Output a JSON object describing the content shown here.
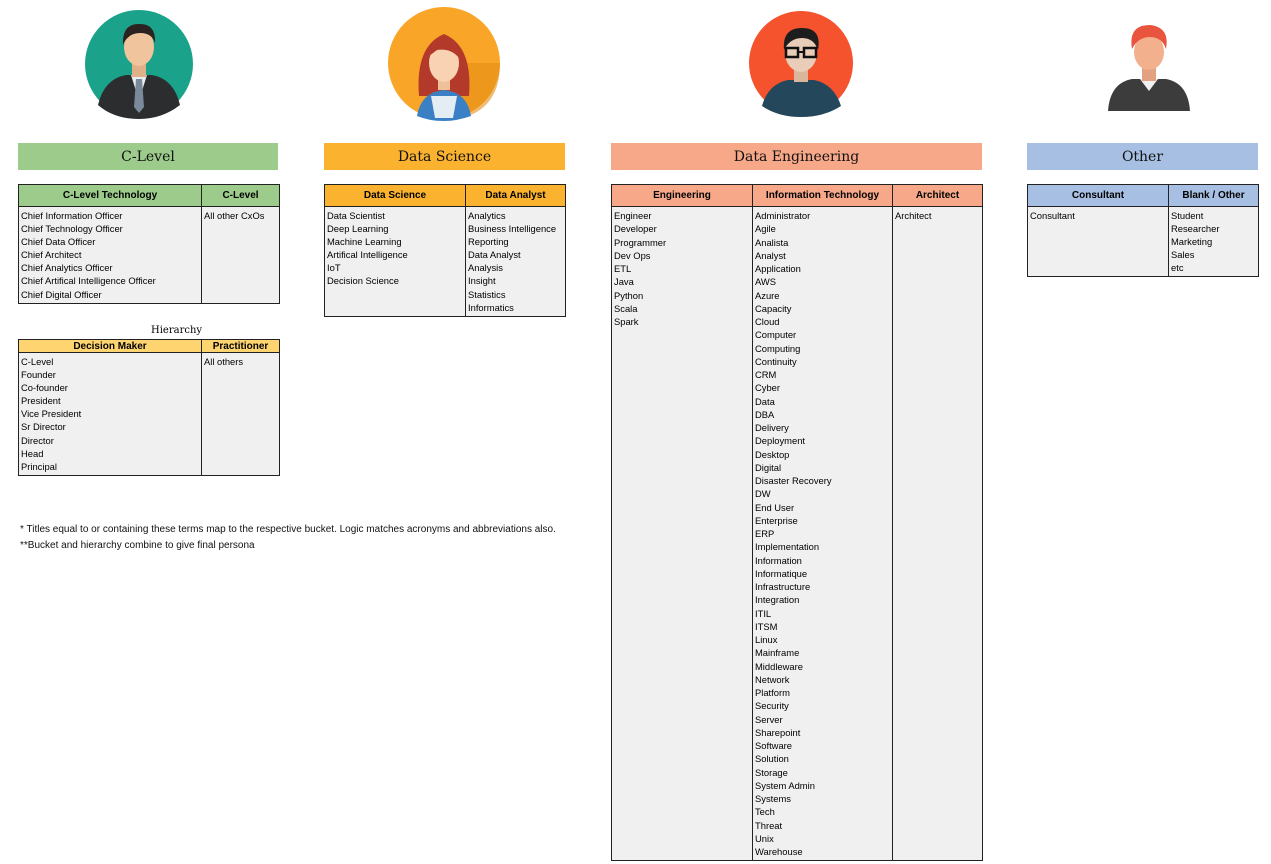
{
  "colors": {
    "clevel": "#9dcb8c",
    "datascience": "#fbb32f",
    "dataeng": "#f6a888",
    "other": "#a6bfe2",
    "hierarchy": "#fdd470"
  },
  "avatars": [
    {
      "name": "man-in-suit-avatar-icon"
    },
    {
      "name": "woman-avatar-icon"
    },
    {
      "name": "man-with-glasses-avatar-icon"
    },
    {
      "name": "redhead-man-avatar-icon"
    }
  ],
  "buckets": {
    "clevel": "C-Level",
    "datascience": "Data Science",
    "dataeng": "Data Engineering",
    "other": "Other"
  },
  "clevel_table": {
    "headers": [
      "C-Level Technology",
      "C-Level"
    ],
    "col1": [
      "Chief Information Officer",
      "Chief Technology Officer",
      "Chief Data Officer",
      "Chief Architect",
      "Chief Analytics Officer",
      "Chief Artifical Intelligence Officer",
      "Chief Digital Officer"
    ],
    "col2": [
      "All other CxOs"
    ]
  },
  "hierarchy": {
    "caption": "Hierarchy",
    "headers": [
      "Decision Maker",
      "Practitioner"
    ],
    "col1": [
      "C-Level",
      "Founder",
      "Co-founder",
      "President",
      "Vice President",
      "Sr Director",
      "Director",
      "Head",
      "Principal"
    ],
    "col2": [
      "All others"
    ]
  },
  "ds_table": {
    "headers": [
      "Data Science",
      "Data Analyst"
    ],
    "col1": [
      "Data Scientist",
      "Deep Learning",
      "Machine Learning",
      "Artifical Intelligence",
      "IoT",
      "Decision Science"
    ],
    "col2": [
      "Analytics",
      "Business Intelligence",
      "Reporting",
      "Data Analyst",
      "Analysis",
      "Insight",
      "Statistics",
      "Informatics"
    ]
  },
  "de_table": {
    "headers": [
      "Engineering",
      "Information Technology",
      "Architect"
    ],
    "col1": [
      "Engineer",
      "Developer",
      "Programmer",
      "Dev Ops",
      "ETL",
      "Java",
      "Python",
      "Scala",
      "Spark"
    ],
    "col2": [
      "Administrator",
      "Agile",
      "Analista",
      "Analyst",
      "Application",
      "AWS",
      "Azure",
      "Capacity",
      "Cloud",
      "Computer",
      "Computing",
      "Continuity",
      "CRM",
      "Cyber",
      "Data",
      "DBA",
      "Delivery",
      "Deployment",
      "Desktop",
      "Digital",
      "Disaster Recovery",
      "DW",
      "End User",
      "Enterprise",
      "ERP",
      "Implementation",
      "Information",
      "Informatique",
      "Infrastructure",
      "Integration",
      "ITIL",
      "ITSM",
      "Linux",
      "Mainframe",
      "Middleware",
      "Network",
      "Platform",
      "Security",
      "Server",
      "Sharepoint",
      "Software",
      "Solution",
      "Storage",
      "System Admin",
      "Systems",
      "Tech",
      "Threat",
      "Unix",
      "Warehouse"
    ],
    "col3": [
      "Architect"
    ]
  },
  "other_table": {
    "headers": [
      "Consultant",
      "Blank / Other"
    ],
    "col1": [
      "Consultant"
    ],
    "col2": [
      "Student",
      "Researcher",
      "Marketing",
      "Sales",
      "etc"
    ]
  },
  "notes": [
    "* Titles equal to or containing these terms map to the respective bucket. Logic matches acronyms and abbreviations also.",
    "**Bucket and hierarchy combine to give final persona"
  ]
}
